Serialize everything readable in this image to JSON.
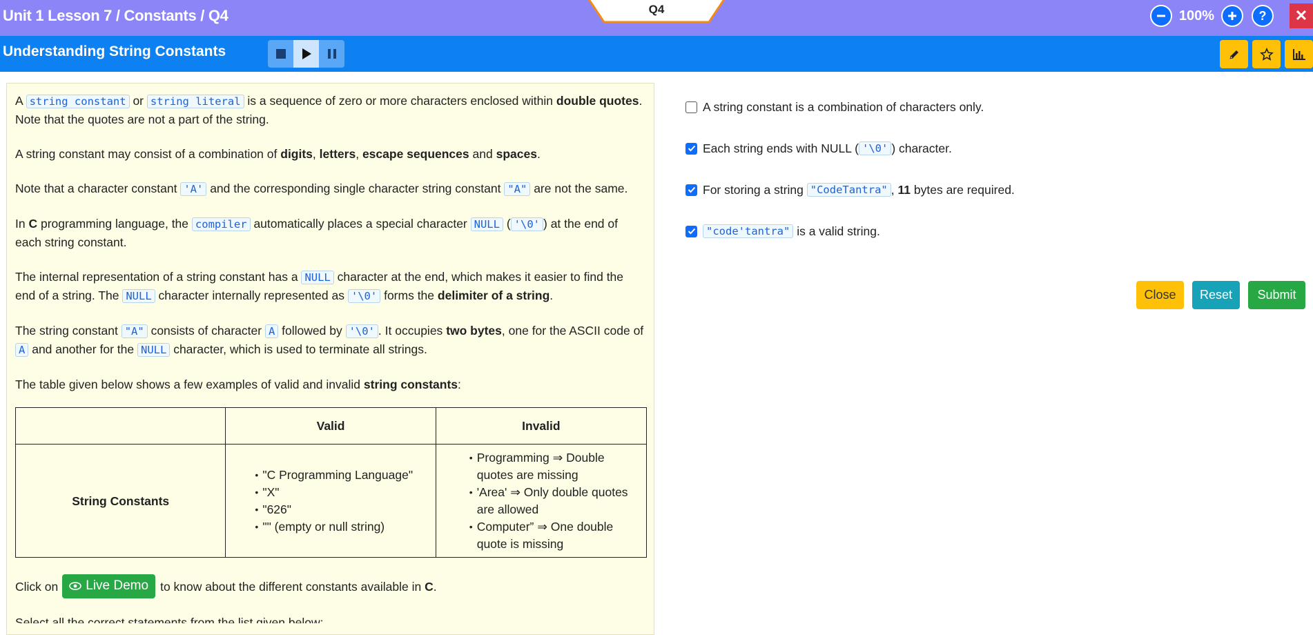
{
  "header": {
    "breadcrumb": "Unit 1 Lesson 7 / Constants / Q4",
    "question_tab": "Q4",
    "zoom": "100%",
    "zoom_out_icon": "minus-circle-icon",
    "zoom_in_icon": "plus-circle-icon",
    "help_icon": "question-icon",
    "close_icon": "close-icon"
  },
  "subheader": {
    "title": "Understanding String Constants",
    "media_icons": [
      "stop-icon",
      "play-icon",
      "pause-icon"
    ],
    "right_icons": [
      "pencil-icon",
      "star-icon",
      "bar-chart-icon"
    ]
  },
  "content": {
    "p1": {
      "a": "A",
      "code1": "string constant",
      "or": "or",
      "code2": "string literal",
      "t1": "is a sequence of zero or more characters enclosed within",
      "b1": "double quotes",
      "t2": ". Note that the quotes are not a part of the string."
    },
    "p2": {
      "t1": "A string constant may consist of a combination of",
      "b1": "digits",
      "s1": ",",
      "b2": "letters",
      "s2": ",",
      "b3": "escape sequences",
      "and": "and",
      "b4": "spaces",
      "end": "."
    },
    "p3": {
      "t1": "Note that a character constant",
      "code1": "'A'",
      "t2": "and the corresponding single character string constant",
      "code2": "\"A\"",
      "t3": "are not the same."
    },
    "p4": {
      "t1": "In",
      "b1": "C",
      "t2": "programming language, the",
      "code1": "compiler",
      "t3": "automatically places a special character",
      "code2": "NULL",
      "t4": "(",
      "code3": "'\\0'",
      "t5": ") at the end of each string constant."
    },
    "p5": {
      "t1": "The internal representation of a string constant has a",
      "code1": "NULL",
      "t2": "character at the end, which makes it easier to find the end of a string. The",
      "code2": "NULL",
      "t3": "character internally represented as",
      "code3": "'\\0'",
      "t4": "forms the",
      "b1": "delimiter of a string",
      "end": "."
    },
    "p6": {
      "t1": "The string constant",
      "code1": "\"A\"",
      "t2": "consists of character",
      "code2": "A",
      "t3": "followed by",
      "code3": "'\\0'",
      "t4": ". It occupies",
      "b1": "two bytes",
      "t5": ", one for the ASCII code of",
      "code4": "A",
      "t6": "and another for the",
      "code5": "NULL",
      "t7": "character, which is used to terminate all strings."
    },
    "p7": {
      "t1": "The table given below shows a few examples of valid and invalid",
      "b1": "string constants",
      "end": ":"
    },
    "table": {
      "headers": [
        "",
        "Valid",
        "Invalid"
      ],
      "row_label": "String Constants",
      "valid": [
        "\"C Programming Language\"",
        "\"X\"",
        "\"626\"",
        "\"\" (empty or null string)"
      ],
      "invalid": [
        "Programming ⇒ Double quotes are missing",
        "'Area' ⇒ Only double quotes are allowed",
        "Computer” ⇒ One double quote is missing"
      ]
    },
    "demo": {
      "t1": "Click on",
      "button_label": "Live Demo",
      "button_icon": "eye-icon",
      "t2": "to know about the different constants available in",
      "b1": "C",
      "end": "."
    },
    "cut_text": "Select all the correct statements from the list given below:"
  },
  "options": [
    {
      "checked": false,
      "t1": "A string constant is a combination of characters only."
    },
    {
      "checked": true,
      "t1": "Each string ends with NULL (",
      "code": "'\\0'",
      "t2": ") character."
    },
    {
      "checked": true,
      "t1": "For storing a string",
      "code": "\"CodeTantra\"",
      "t2": ",",
      "b": "11",
      "t3": "bytes are required."
    },
    {
      "checked": true,
      "code": "\"code'tantra\"",
      "t2": "is a valid string."
    }
  ],
  "actions": {
    "close": "Close",
    "reset": "Reset",
    "submit": "Submit"
  },
  "colors": {
    "top_bar": "#8c85f7",
    "sub_bar": "#0d80f2",
    "panel_bg": "#fefee6",
    "code_text": "#1d62d8",
    "close_btn": "#ffc107",
    "reset_btn": "#17a2b8",
    "submit_btn": "#28a745",
    "exit_btn": "#dc3545"
  }
}
